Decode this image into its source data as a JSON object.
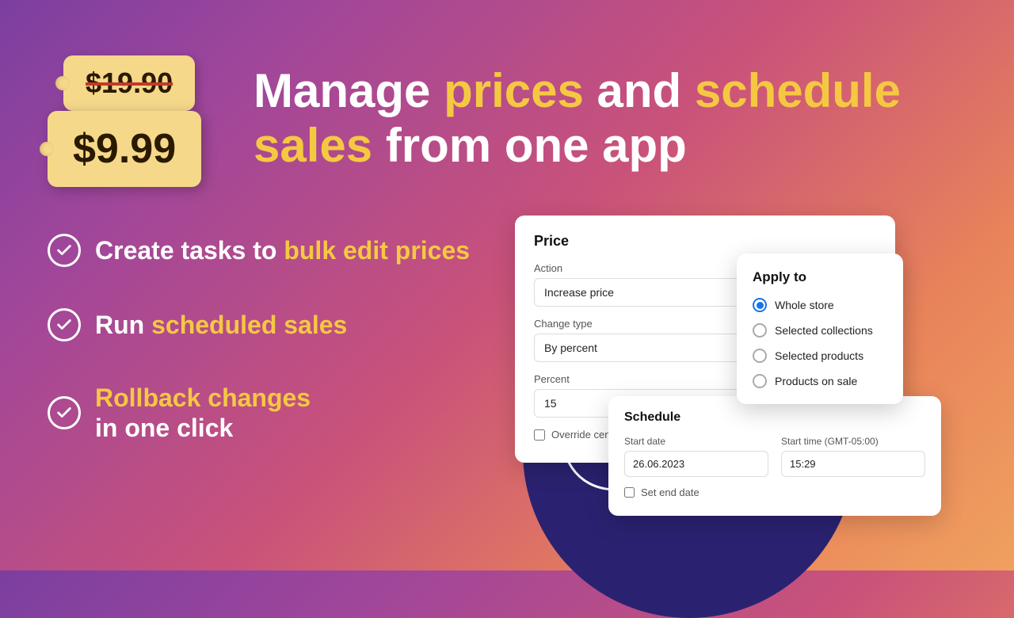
{
  "background": {
    "gradient_start": "#7b3fa0",
    "gradient_end": "#f0a060"
  },
  "price_tags": {
    "old_price": "$19.90",
    "new_price": "$9.99"
  },
  "headline": {
    "part1": "Manage ",
    "accent1": "prices",
    "part2": " and ",
    "accent2": "schedule",
    "part3": " sales",
    "part4": " from one app"
  },
  "features": [
    {
      "text_plain": "Create tasks to ",
      "text_accent": "bulk edit prices",
      "text_rest": ""
    },
    {
      "text_plain": "Run ",
      "text_accent": "scheduled sales",
      "text_rest": ""
    },
    {
      "text_plain": "Rollback changes\nin one click",
      "text_accent": "",
      "text_rest": ""
    }
  ],
  "price_card": {
    "title": "Price",
    "action_label": "Action",
    "action_value": "Increase price",
    "change_type_label": "Change type",
    "change_type_value": "By percent",
    "percent_label": "Percent",
    "percent_value": "15",
    "override_label": "Override cents"
  },
  "apply_card": {
    "title": "Apply to",
    "options": [
      {
        "label": "Whole store",
        "selected": true
      },
      {
        "label": "Selected collections",
        "selected": false
      },
      {
        "label": "Selected products",
        "selected": false
      },
      {
        "label": "Products on sale",
        "selected": false
      }
    ]
  },
  "schedule_card": {
    "title": "Schedule",
    "start_date_label": "Start date",
    "start_date_value": "26.06.2023",
    "start_time_label": "Start time (GMT-05:00)",
    "start_time_value": "15:29",
    "end_date_label": "Set end date"
  }
}
